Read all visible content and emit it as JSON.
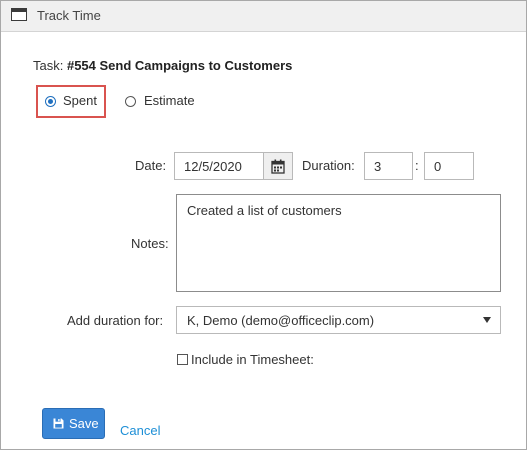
{
  "window": {
    "title": "Track Time",
    "icon": "window-icon"
  },
  "task": {
    "label": "Task:",
    "name": "#554 Send Campaigns to Customers"
  },
  "type_options": [
    {
      "label": "Spent",
      "selected": true
    },
    {
      "label": "Estimate",
      "selected": false
    }
  ],
  "date": {
    "label": "Date:",
    "value": "12/5/2020",
    "icon": "calendar-icon"
  },
  "duration": {
    "label": "Duration:",
    "hours": "3",
    "separator": ":",
    "minutes": "0"
  },
  "notes": {
    "label": "Notes:",
    "value": "Created a list of customers"
  },
  "add_duration": {
    "label": "Add duration for:",
    "selected": "K, Demo (demo@officeclip.com)"
  },
  "include_timesheet": {
    "label": "Include in Timesheet:",
    "checked": false
  },
  "actions": {
    "save_label": "Save",
    "cancel_label": "Cancel"
  },
  "colors": {
    "primary_button": "#3a86d6",
    "link": "#1e8fd6",
    "highlight": "#d9534f",
    "radio_selected": "#1f6fbf"
  }
}
